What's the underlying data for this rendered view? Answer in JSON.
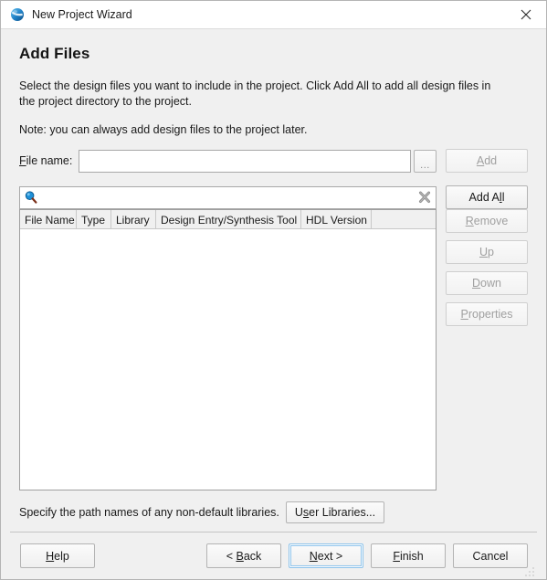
{
  "window": {
    "title": "New Project Wizard",
    "icon": "globe-icon",
    "close_label": "×"
  },
  "page": {
    "heading": "Add Files",
    "description": "Select the design files you want to include in the project. Click Add All to add all design files in the project directory to the project.",
    "note": "Note: you can always add design files to the project later."
  },
  "file_name_row": {
    "label_pre": "F",
    "label_mnemonic": "F",
    "label_rest": "ile name:",
    "input_value": "",
    "input_placeholder": "",
    "browse_label": "...",
    "add_label_mnemonic": "A",
    "add_label_rest": "dd",
    "add_label": "Add",
    "add_enabled": false
  },
  "search_row": {
    "input_value": "",
    "input_placeholder": "",
    "search_icon": "magnifier-icon",
    "clear_icon": "clear-x-icon",
    "add_all_label": "Add All",
    "add_all_enabled": true
  },
  "side_buttons": [
    {
      "label": "Add",
      "mnemonic": "A",
      "enabled": false,
      "name": "add-button"
    },
    {
      "label": "Add All",
      "mnemonic": "l",
      "enabled": true,
      "name": "add-all-button"
    },
    {
      "label": "Remove",
      "mnemonic": "R",
      "enabled": false,
      "name": "remove-button"
    },
    {
      "label": "Up",
      "mnemonic": "U",
      "enabled": false,
      "name": "up-button"
    },
    {
      "label": "Down",
      "mnemonic": "D",
      "enabled": false,
      "name": "down-button"
    },
    {
      "label": "Properties",
      "mnemonic": "P",
      "enabled": false,
      "name": "properties-button"
    }
  ],
  "table": {
    "columns": [
      {
        "label": "File Name",
        "width": 62
      },
      {
        "label": "Type",
        "width": 38
      },
      {
        "label": "Library",
        "width": 49
      },
      {
        "label": "Design Entry/Synthesis Tool",
        "width": 159
      },
      {
        "label": "HDL Version",
        "width": 77
      }
    ],
    "rows": []
  },
  "libraries_row": {
    "text": "Specify the path names of any non-default libraries.",
    "button_label": "User Libraries...",
    "button_mnemonic": "s"
  },
  "footer": {
    "help": {
      "label": "Help",
      "mnemonic": "H"
    },
    "back": {
      "label": "< Back",
      "mnemonic": "B"
    },
    "next": {
      "label": "Next >",
      "mnemonic": "N",
      "focused": true
    },
    "finish": {
      "label": "Finish",
      "mnemonic": "F"
    },
    "cancel": {
      "label": "Cancel",
      "mnemonic": ""
    }
  },
  "colors": {
    "window_bg": "#f0f0f0",
    "titlebar_bg": "#ffffff",
    "field_bg": "#ffffff",
    "border": "#a9a9a9",
    "focus_blue": "#8fc4ec",
    "accent_blue": "#1e90d8"
  }
}
